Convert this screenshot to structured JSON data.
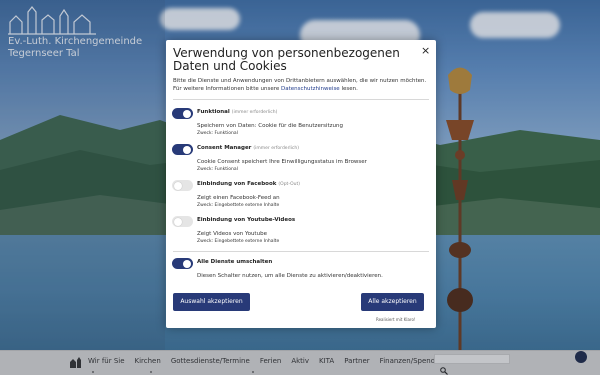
{
  "site": {
    "title_line1": "Ev.-Luth. Kirchengemeinde",
    "title_line2": "Tegernseer Tal"
  },
  "modal": {
    "title": "Verwendung von personenbezogenen Daten und Cookies",
    "close_label": "×",
    "intro_text": "Bitte die Dienste und Anwendungen von Drittanbietern auswählen, die wir nutzen möchten. Für weitere Informationen bitte unsere",
    "intro_link": "Datenschutzhinweise",
    "intro_suffix": "lesen.",
    "services": [
      {
        "name": "Funktional",
        "tag": "(immer erforderlich)",
        "description": "Speichern von Daten: Cookie für die Benutzersitzung",
        "purpose": "Zweck: Funktional",
        "enabled": true
      },
      {
        "name": "Consent Manager",
        "tag": "(immer erforderlich)",
        "description": "Cookie Consent speichert Ihre Einwilligungsstatus im Browser",
        "purpose": "Zweck: Funktional",
        "enabled": true
      },
      {
        "name": "Einbindung von Facebook",
        "tag": "(Opt-Out)",
        "description": "Zeigt einen Facebook-Feed an",
        "purpose": "Zweck: Eingebettete externe Inhalte",
        "enabled": false
      },
      {
        "name": "Einbindung von Youtube-Videos",
        "tag": "",
        "description": "Zeigt Videos von Youtube",
        "purpose": "Zweck: Eingebettete externe Inhalte",
        "enabled": false
      }
    ],
    "toggle_all": {
      "name": "Alle Dienste umschalten",
      "description": "Diesen Schalter nutzen, um alle Dienste zu aktivieren/deaktivieren.",
      "enabled": true
    },
    "accept_selection_label": "Auswahl akzeptieren",
    "accept_all_label": "Alle akzeptieren",
    "powered_by": "Realisiert mit Klaro!"
  },
  "nav": {
    "items": [
      "Wir für Sie",
      "Kirchen",
      "Gottesdienste/Termine",
      "Ferien",
      "Aktiv",
      "KITA",
      "Partner",
      "Finanzen/Spenden"
    ]
  },
  "colors": {
    "accent": "#283a78",
    "nav_bg": "#cfcfcf"
  },
  "icons": [
    "church-home-icon",
    "search-icon",
    "privacy-fingerprint-icon",
    "close-icon"
  ]
}
